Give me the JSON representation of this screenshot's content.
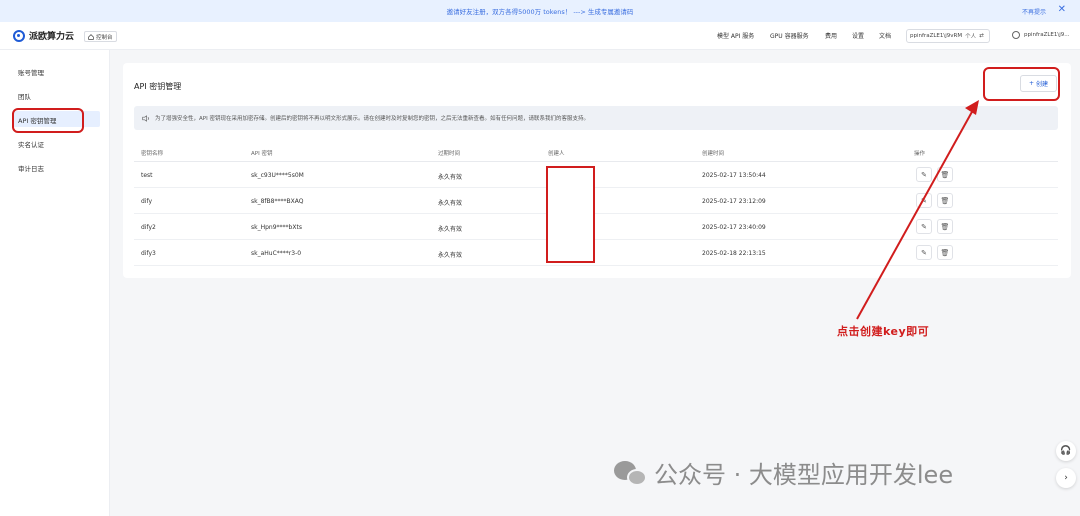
{
  "banner": {
    "text": "邀请好友注册，双方各得5000万 tokens！ ---> 生成专属邀请码",
    "right": "不再提示",
    "close": "✕"
  },
  "header": {
    "brand": "派欧算力云",
    "console": "控制台",
    "nav": [
      "模型 API 服务",
      "GPU 容器服务",
      "费用",
      "设置",
      "文档"
    ],
    "account": "ppinfraZLE1\\j9vRM",
    "account_badge": "个人",
    "user": "ppinfraZLE1\\j9..."
  },
  "sidebar": {
    "items": [
      "账号管理",
      "团队",
      "API 密钥管理",
      "实名认证",
      "审计日志"
    ],
    "active_index": 2
  },
  "card": {
    "title": "API 密钥管理",
    "create_label": "创建",
    "notice": "为了增强安全性，API 密钥现在采用加密存储。创建后的密钥将不再以明文形式展示。请在创建时及时复制您的密钥，之后无法重新查看。如有任何问题，请联系我们的客服支持。"
  },
  "table": {
    "columns": [
      "密钥名称",
      "API 密钥",
      "过期时间",
      "创建人",
      "创建时间",
      "操作"
    ],
    "rows": [
      {
        "name": "test",
        "key": "sk_c93U****5s0M",
        "expire": "永久有效",
        "created": "2025-02-17 13:50:44"
      },
      {
        "name": "dify",
        "key": "sk_8fB8****BXAQ",
        "expire": "永久有效",
        "created": "2025-02-17 23:12:09"
      },
      {
        "name": "dify2",
        "key": "sk_Hpn9****bXts",
        "expire": "永久有效",
        "created": "2025-02-17 23:40:09"
      },
      {
        "name": "dify3",
        "key": "sk_aHuC****r3-0",
        "expire": "永久有效",
        "created": "2025-02-18 22:13:15"
      }
    ]
  },
  "annotation": "点击创建key即可",
  "watermark": "公众号 · 大模型应用开发lee",
  "colors": {
    "accent": "#1f5bd6",
    "annotation_red": "#d11d1d"
  }
}
